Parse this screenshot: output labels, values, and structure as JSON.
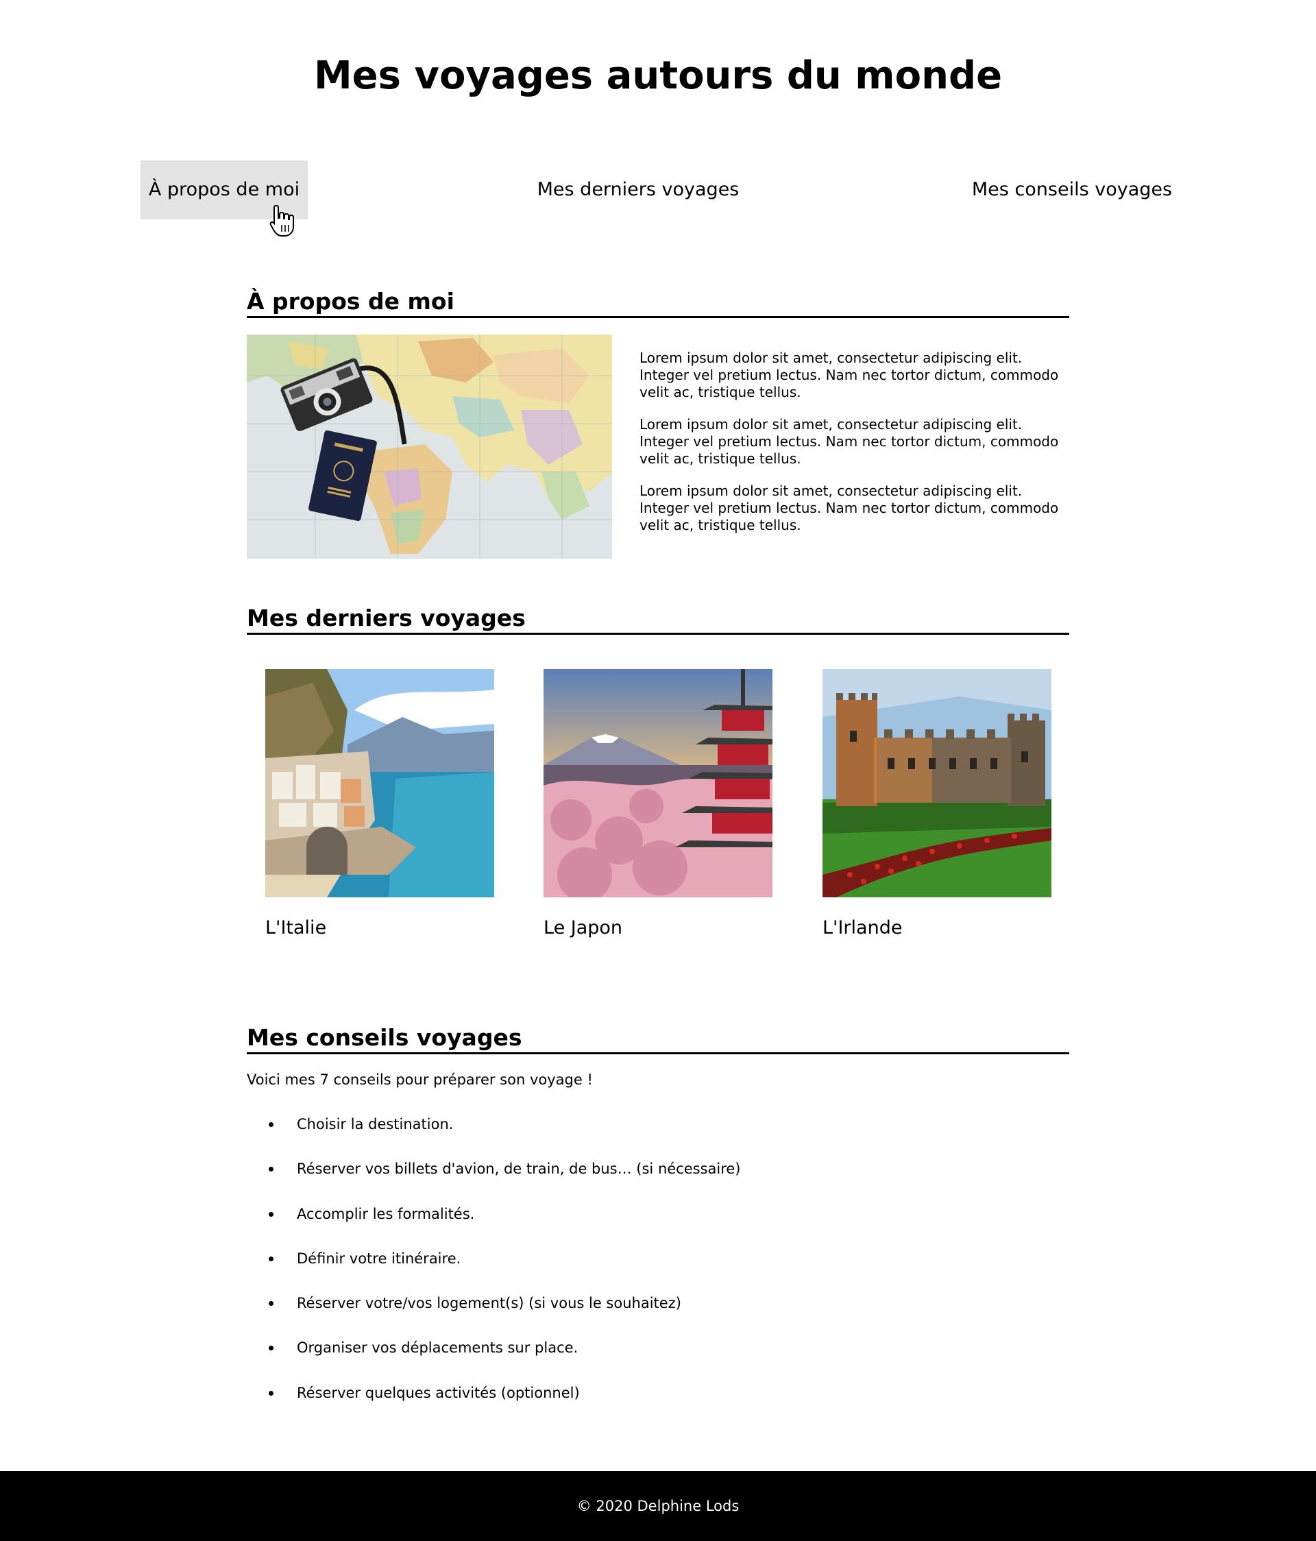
{
  "header": {
    "title": "Mes voyages autours du monde"
  },
  "nav": {
    "items": [
      {
        "label": "À propos de moi",
        "active": true
      },
      {
        "label": "Mes derniers voyages",
        "active": false
      },
      {
        "label": "Mes conseils voyages",
        "active": false
      }
    ]
  },
  "about": {
    "heading": "À propos de moi",
    "image_icon": "map-camera-passport-photo",
    "paragraphs": [
      "Lorem ipsum dolor sit amet, consectetur adipiscing elit. Integer vel pretium lectus. Nam nec tortor dictum, commodo velit ac, tristique tellus.",
      "Lorem ipsum dolor sit amet, consectetur adipiscing elit. Integer vel pretium lectus. Nam nec tortor dictum, commodo velit ac, tristique tellus.",
      "Lorem ipsum dolor sit amet, consectetur adipiscing elit. Integer vel pretium lectus. Nam nec tortor dictum, commodo velit ac, tristique tellus."
    ]
  },
  "trips": {
    "heading": "Mes derniers voyages",
    "items": [
      {
        "name": "L'Italie",
        "image_icon": "amalfi-coast-photo"
      },
      {
        "name": "Le Japon",
        "image_icon": "pagoda-fuji-photo"
      },
      {
        "name": "L'Irlande",
        "image_icon": "castle-photo"
      }
    ]
  },
  "tips": {
    "heading": "Mes conseils voyages",
    "intro": "Voici mes 7 conseils pour préparer son voyage !",
    "items": [
      "Choisir la destination.",
      "Réserver vos billets d'avion, de train, de bus… (si nécessaire)",
      "Accomplir les formalités.",
      "Définir votre itinéraire.",
      "Réserver votre/vos logement(s) (si vous le souhaitez)",
      "Organiser vos déplacements sur place.",
      "Réserver quelques activités (optionnel)"
    ]
  },
  "footer": {
    "text": "© 2020 Delphine Lods"
  },
  "colors": {
    "nav_active_bg": "#e3e3e3",
    "footer_bg": "#000000",
    "footer_text": "#ffffff"
  }
}
